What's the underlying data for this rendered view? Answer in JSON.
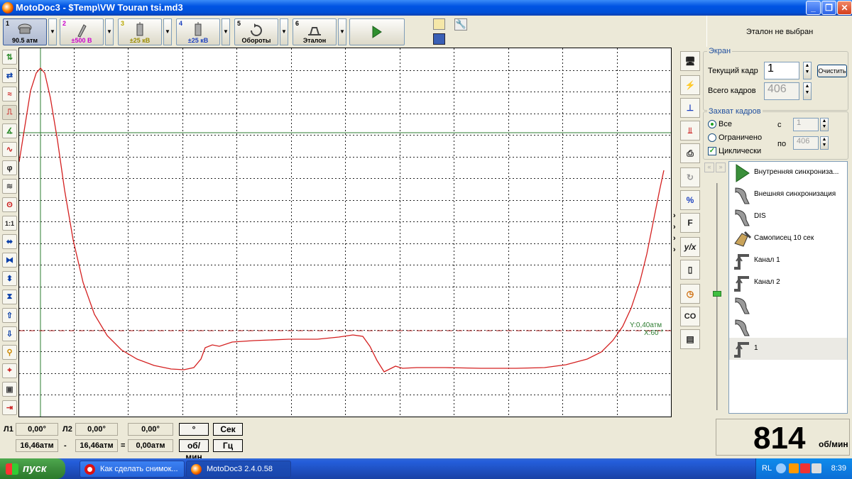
{
  "window": {
    "title": "MotoDoc3 - $Temp\\VW Touran tsi.md3"
  },
  "toolbar": {
    "channels": [
      {
        "num": "1",
        "label": "90.5 атм"
      },
      {
        "num": "2",
        "label": "±500 В"
      },
      {
        "num": "3",
        "label": "±25 кВ"
      },
      {
        "num": "4",
        "label": "±25 кВ"
      },
      {
        "num": "5",
        "label": "Обороты"
      },
      {
        "num": "6",
        "label": "Эталон"
      }
    ]
  },
  "status": {
    "reference": "Эталон не выбран"
  },
  "screen": {
    "group_title": "Экран",
    "current_frame_label": "Текущий кадр",
    "current_frame_value": "1",
    "clear_button": "Очистить",
    "total_frames_label": "Всего кадров",
    "total_frames_value": "406"
  },
  "capture": {
    "group_title": "Захват кадров",
    "opt_all": "Все",
    "opt_limited": "Ограничено",
    "cyclic": "Циклически",
    "from_label": "с",
    "from_value": "1",
    "to_label": "по",
    "to_value": "406"
  },
  "sync": {
    "items": [
      {
        "label": "Внутренняя синхрониза..."
      },
      {
        "label": "Внешняя синхронизация"
      },
      {
        "label": "DIS"
      },
      {
        "label": "Самописец 10 сек"
      },
      {
        "label": "Канал 1"
      },
      {
        "label": "Канал 2"
      },
      {
        "label": ""
      },
      {
        "label": ""
      },
      {
        "label": "1"
      }
    ]
  },
  "scope": {
    "cursor_y": "Y:0,40атм",
    "cursor_x": "X:60 °",
    "trace_color": "#d42020",
    "marker_color": "#2e7d32"
  },
  "bottom": {
    "l1_label": "Л1",
    "l1_value": "0,00°",
    "l2_label": "Л2",
    "l2_value": "0,00°",
    "diff_value": "0,00°",
    "deg_button": "°",
    "sec_button": "Сек",
    "p1_value": "16,46атм",
    "minus": "-",
    "p2_value": "16,46атм",
    "equals": "=",
    "pdiff_value": "0,00атм",
    "rpm_button": "об/мин",
    "hz_button": "Гц"
  },
  "rpm": {
    "value": "814",
    "unit": "об/мин"
  },
  "taskbar": {
    "start": "пуск",
    "tasks": [
      {
        "label": "Как сделать снимок..."
      },
      {
        "label": "MotoDoc3 2.4.0.58"
      }
    ],
    "lang": "RL",
    "clock": "8:39"
  }
}
